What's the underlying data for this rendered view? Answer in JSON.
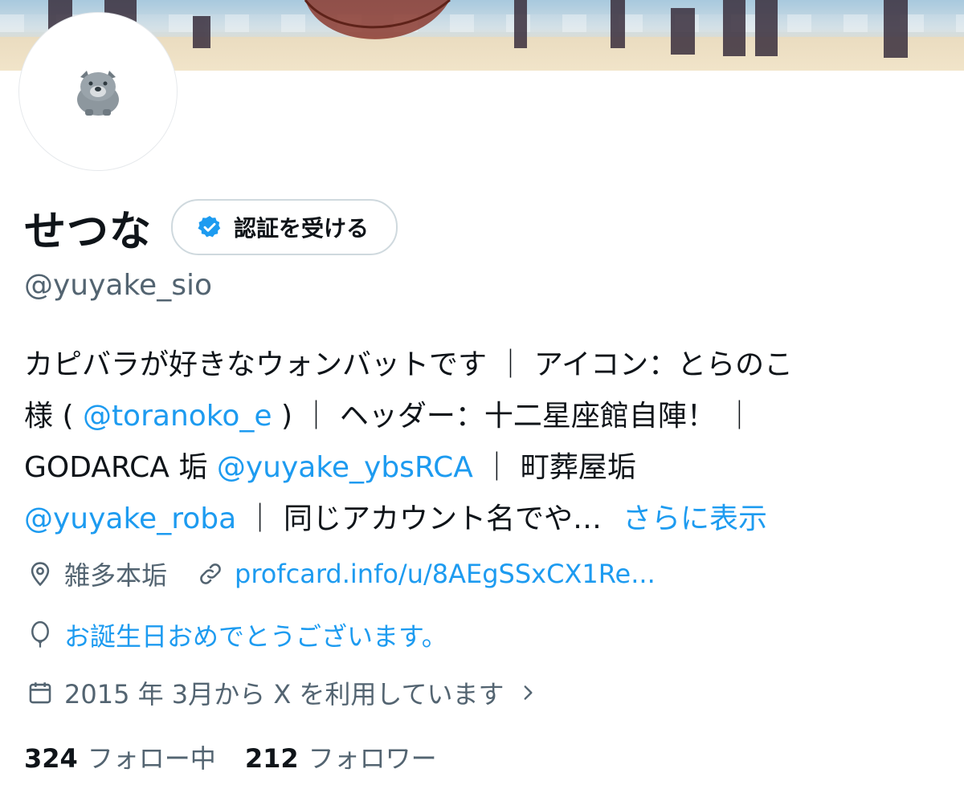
{
  "profile": {
    "display_name": "せつな",
    "verify_button_label": "認証を受ける",
    "handle": "@yuyake_sio"
  },
  "bio": {
    "line1": "カピバラが好きなウォンバットです ｜ アイコン：とらのこ",
    "line2_pre": "様 ( ",
    "line2_link": "@toranoko_e",
    "line2_post": " ) ｜ ヘッダー：十二星座館自陣！ ｜",
    "line3_pre": "GODARCA 垢 ",
    "line3_link": "@yuyake_ybsRCA",
    "line3_post": " ｜ 町葬屋垢",
    "line4_link": "@yuyake_roba",
    "line4_mid": " ｜ 同じアカウント名でや…",
    "show_more": "さらに表示"
  },
  "meta": {
    "location": "雑多本垢",
    "website": "profcard.info/u/8AEgSSxCX1Re...",
    "birthday": "お誕生日おめでとうございます。",
    "joined": "2015 年 3月から X を利用しています",
    "icons": {
      "location": "location-pin-icon",
      "website": "link-icon",
      "birthday": "balloon-icon",
      "joined": "calendar-icon",
      "chevron": "chevron-right-icon"
    }
  },
  "stats": {
    "following_count": "324",
    "following_label": "フォロー中",
    "followers_count": "212",
    "followers_label": "フォロワー"
  },
  "colors": {
    "link": "#1d9bf0",
    "secondary_text": "#536471",
    "primary_text": "#0f1419",
    "border": "#cfd9de"
  }
}
